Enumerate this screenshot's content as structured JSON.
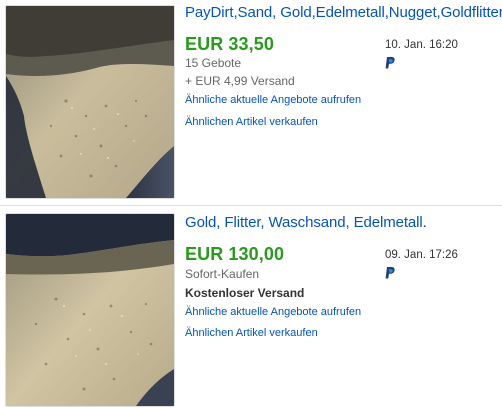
{
  "listings": [
    {
      "title": "PayDirt,Sand, Gold,Edelmetall,Nugget,Goldflitter",
      "price": "EUR 33,50",
      "sub_info": "15 Gebote",
      "shipping": "+ EUR 4,99 Versand",
      "link_similar": "Ähnliche aktuelle Angebote aufrufen",
      "link_sell": "Ähnlichen Artikel verkaufen",
      "end_date": "10. Jan. 16:20",
      "payment_icon": "paypal-icon"
    },
    {
      "title": "Gold, Flitter, Waschsand, Edelmetall.",
      "price": "EUR 130,00",
      "sub_info": "Sofort-Kaufen",
      "shipping": "Kostenloser Versand",
      "link_similar": "Ähnliche aktuelle Angebote aufrufen",
      "link_sell": "Ähnlichen Artikel verkaufen",
      "end_date": "09. Jan. 17:26",
      "payment_icon": "paypal-icon"
    }
  ],
  "colors": {
    "link_blue": "#0654ba",
    "price_green": "#2a9a1e",
    "muted_gray": "#666666",
    "paypal_dark": "#253b80",
    "paypal_light": "#179bd7"
  }
}
